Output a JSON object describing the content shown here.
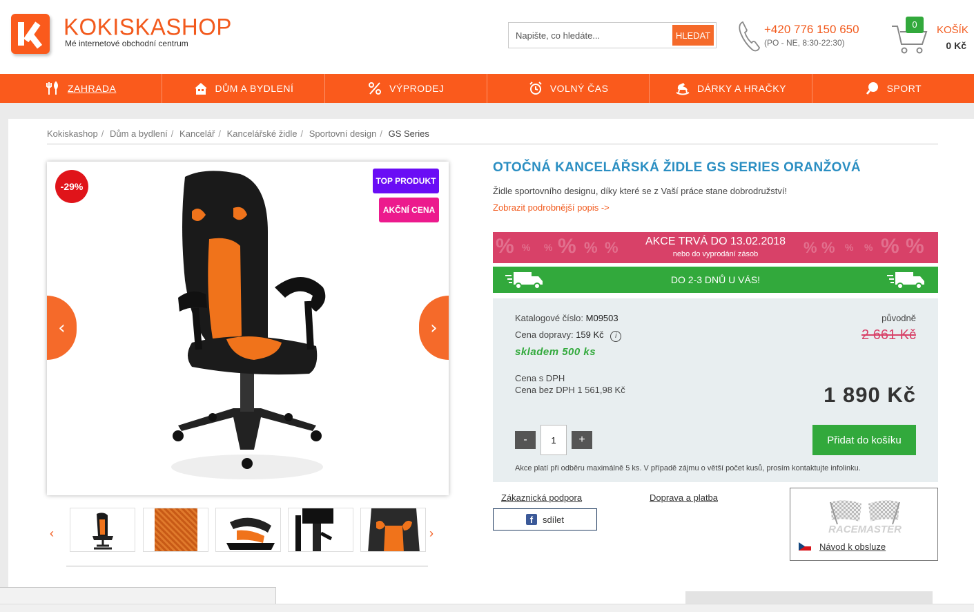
{
  "header": {
    "logo_name": "KOKISKASHOP",
    "logo_tagline": "Mé internetové obchodní centrum",
    "search_placeholder": "Napište, co hledáte...",
    "search_button": "HLEDAT",
    "phone": "+420 776 150 650",
    "phone_hours": "(PO - NE, 8:30-22:30)",
    "cart_label": "KOŠÍK",
    "cart_count": "0",
    "cart_total": "0 Kč"
  },
  "nav": {
    "items": [
      {
        "label": "ZAHRADA",
        "icon": "garden-tools-icon"
      },
      {
        "label": "DŮM A BYDLENÍ",
        "icon": "house-icon"
      },
      {
        "label": "VÝPRODEJ",
        "icon": "percent-icon"
      },
      {
        "label": "VOLNÝ ČAS",
        "icon": "alarm-clock-icon"
      },
      {
        "label": "DÁRKY A HRAČKY",
        "icon": "rocking-horse-icon"
      },
      {
        "label": "SPORT",
        "icon": "ping-pong-icon"
      }
    ]
  },
  "breadcrumb": {
    "items": [
      "Kokiskashop",
      "Dům a bydlení",
      "Kancelář",
      "Kancelářské židle",
      "Sportovní design"
    ],
    "current": "GS Series",
    "separator": "/"
  },
  "gallery": {
    "discount_badge": "-29%",
    "badge_top": "TOP PRODUKT",
    "badge_sale": "AKČNÍ CENA",
    "prev": "‹",
    "next": "›",
    "thumbs_prev": "‹",
    "thumbs_next": "›"
  },
  "product": {
    "title": "OTOČNÁ KANCELÁŘSKÁ ŽIDLE GS SERIES ORANŽOVÁ",
    "description": "Židle sportovního designu, díky které se z Vaší práce stane dobrodružství!",
    "more_link": "Zobrazit podrobnější popis ->",
    "promo_title": "AKCE TRVÁ DO 13.02.2018",
    "promo_subtitle": "nebo do vyprodání zásob",
    "delivery": "DO 2-3 DNŮ U VÁS!",
    "catalog_label": "Katalogové číslo:",
    "catalog_number": "M09503",
    "shipping_label": "Cena dopravy:",
    "shipping_price": "159 Kč",
    "info_icon": "i",
    "stock": "skladem 500 ks",
    "original_label": "původně",
    "original_price": "2 661 Kč",
    "vat_label": "Cena s DPH",
    "novat_label": "Cena bez DPH 1 561,98 Kč",
    "price": "1 890 Kč",
    "qty_minus": "-",
    "qty_value": "1",
    "qty_plus": "+",
    "add_to_cart": "Přidat do košíku",
    "note": "Akce platí při odběru maximálně 5 ks. V případě zájmu o větší počet kusů, prosím kontaktujte infolinku."
  },
  "links": {
    "support": "Zákaznická podpora",
    "shipping": "Doprava a platba",
    "share": "sdílet",
    "manual": "Návod k obsluze",
    "brand": "RACEMASTER"
  },
  "colors": {
    "brand_orange": "#fa5a1c",
    "promo_pink": "#d84168",
    "green": "#32a93c",
    "title_blue": "#2a8ec2"
  }
}
